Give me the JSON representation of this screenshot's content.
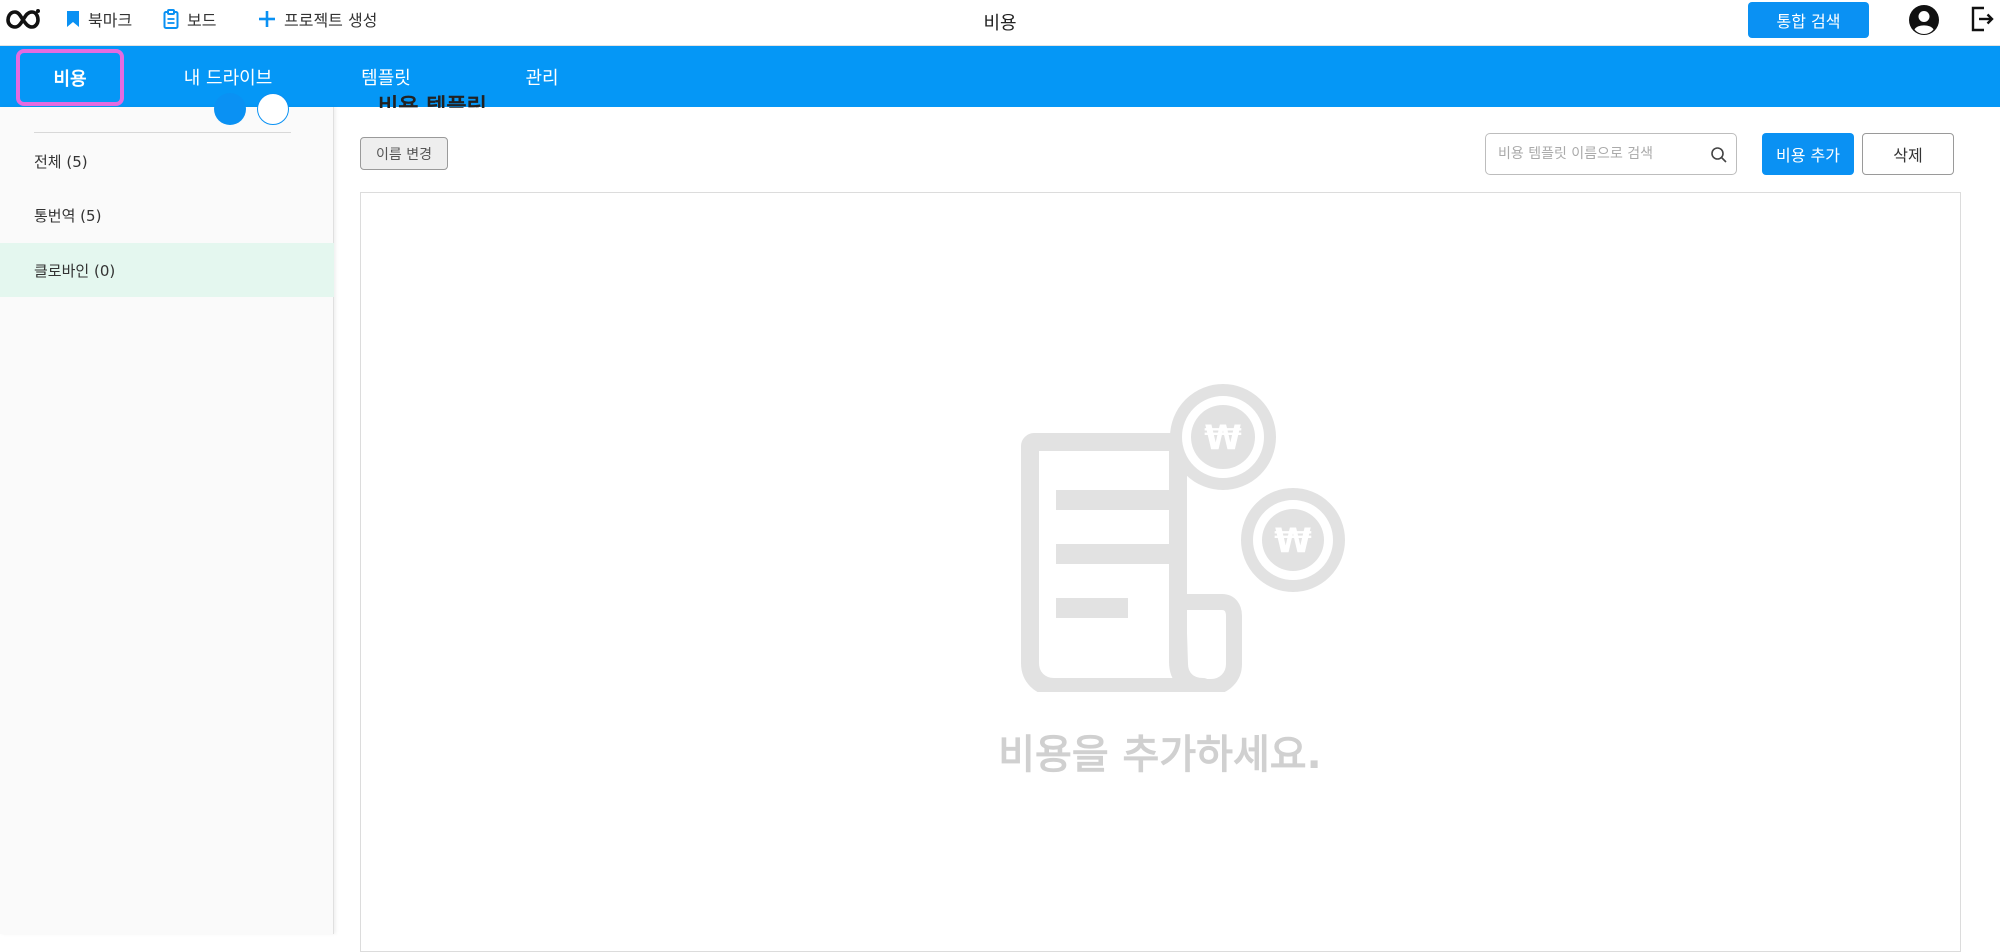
{
  "header": {
    "bookmark_label": "북마크",
    "board_label": "보드",
    "create_project_label": "프로젝트 생성",
    "page_title": "비용",
    "search_all_label": "통합 검색"
  },
  "nav": {
    "tabs": [
      {
        "label": "비용",
        "active": true
      },
      {
        "label": "내 드라이브",
        "active": false
      },
      {
        "label": "템플릿",
        "active": false
      },
      {
        "label": "관리",
        "active": false
      }
    ]
  },
  "sidebar": {
    "items": [
      {
        "label": "전체 (5)",
        "selected": false
      },
      {
        "label": "통번역 (5)",
        "selected": false
      },
      {
        "label": "클로바인 (0)",
        "selected": true
      }
    ]
  },
  "main": {
    "section_title": "비용 템플릿",
    "rename_label": "이름 변경",
    "search_placeholder": "비용 템플릿 이름으로 검색",
    "search_value": "",
    "add_label": "비용 추가",
    "delete_label": "삭제",
    "empty_message": "비용을 추가하세요."
  },
  "colors": {
    "primary": "#0a91f3",
    "nav_bg": "#0597f6",
    "highlight": "#e46be0",
    "selected_bg": "#e4f7ef",
    "empty_gray": "#d0d0d0"
  },
  "icons": [
    "logo-icon",
    "bookmark-icon",
    "board-icon",
    "plus-icon",
    "user-avatar-icon",
    "logout-icon",
    "search-icon",
    "empty-cost-illustration"
  ]
}
